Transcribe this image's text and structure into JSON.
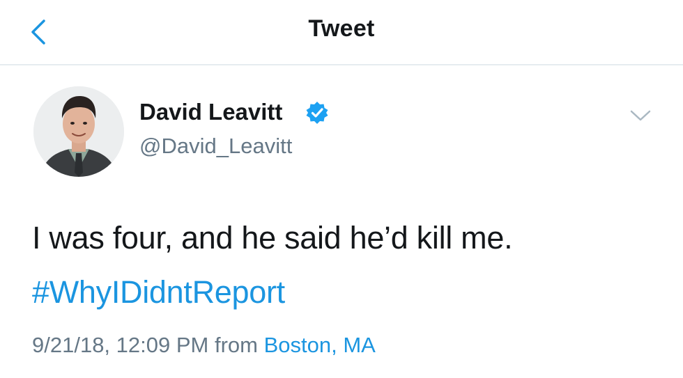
{
  "nav": {
    "title": "Tweet",
    "back_icon": "chevron-left-icon"
  },
  "tweet": {
    "author": {
      "name": "David Leavitt",
      "handle": "@David_Leavitt",
      "verified": true,
      "verified_icon": "verified-badge-icon"
    },
    "text": "I was four, and he said he’d kill me.",
    "hashtag": "#WhyIDidntReport",
    "timestamp": "9/21/18, 12:09 PM",
    "from_label": "from",
    "location": "Boston, MA",
    "menu_icon": "chevron-down-icon"
  },
  "colors": {
    "accent": "#1b95e0",
    "text": "#14171a",
    "secondary": "#657786",
    "divider": "#e6ecf0"
  }
}
